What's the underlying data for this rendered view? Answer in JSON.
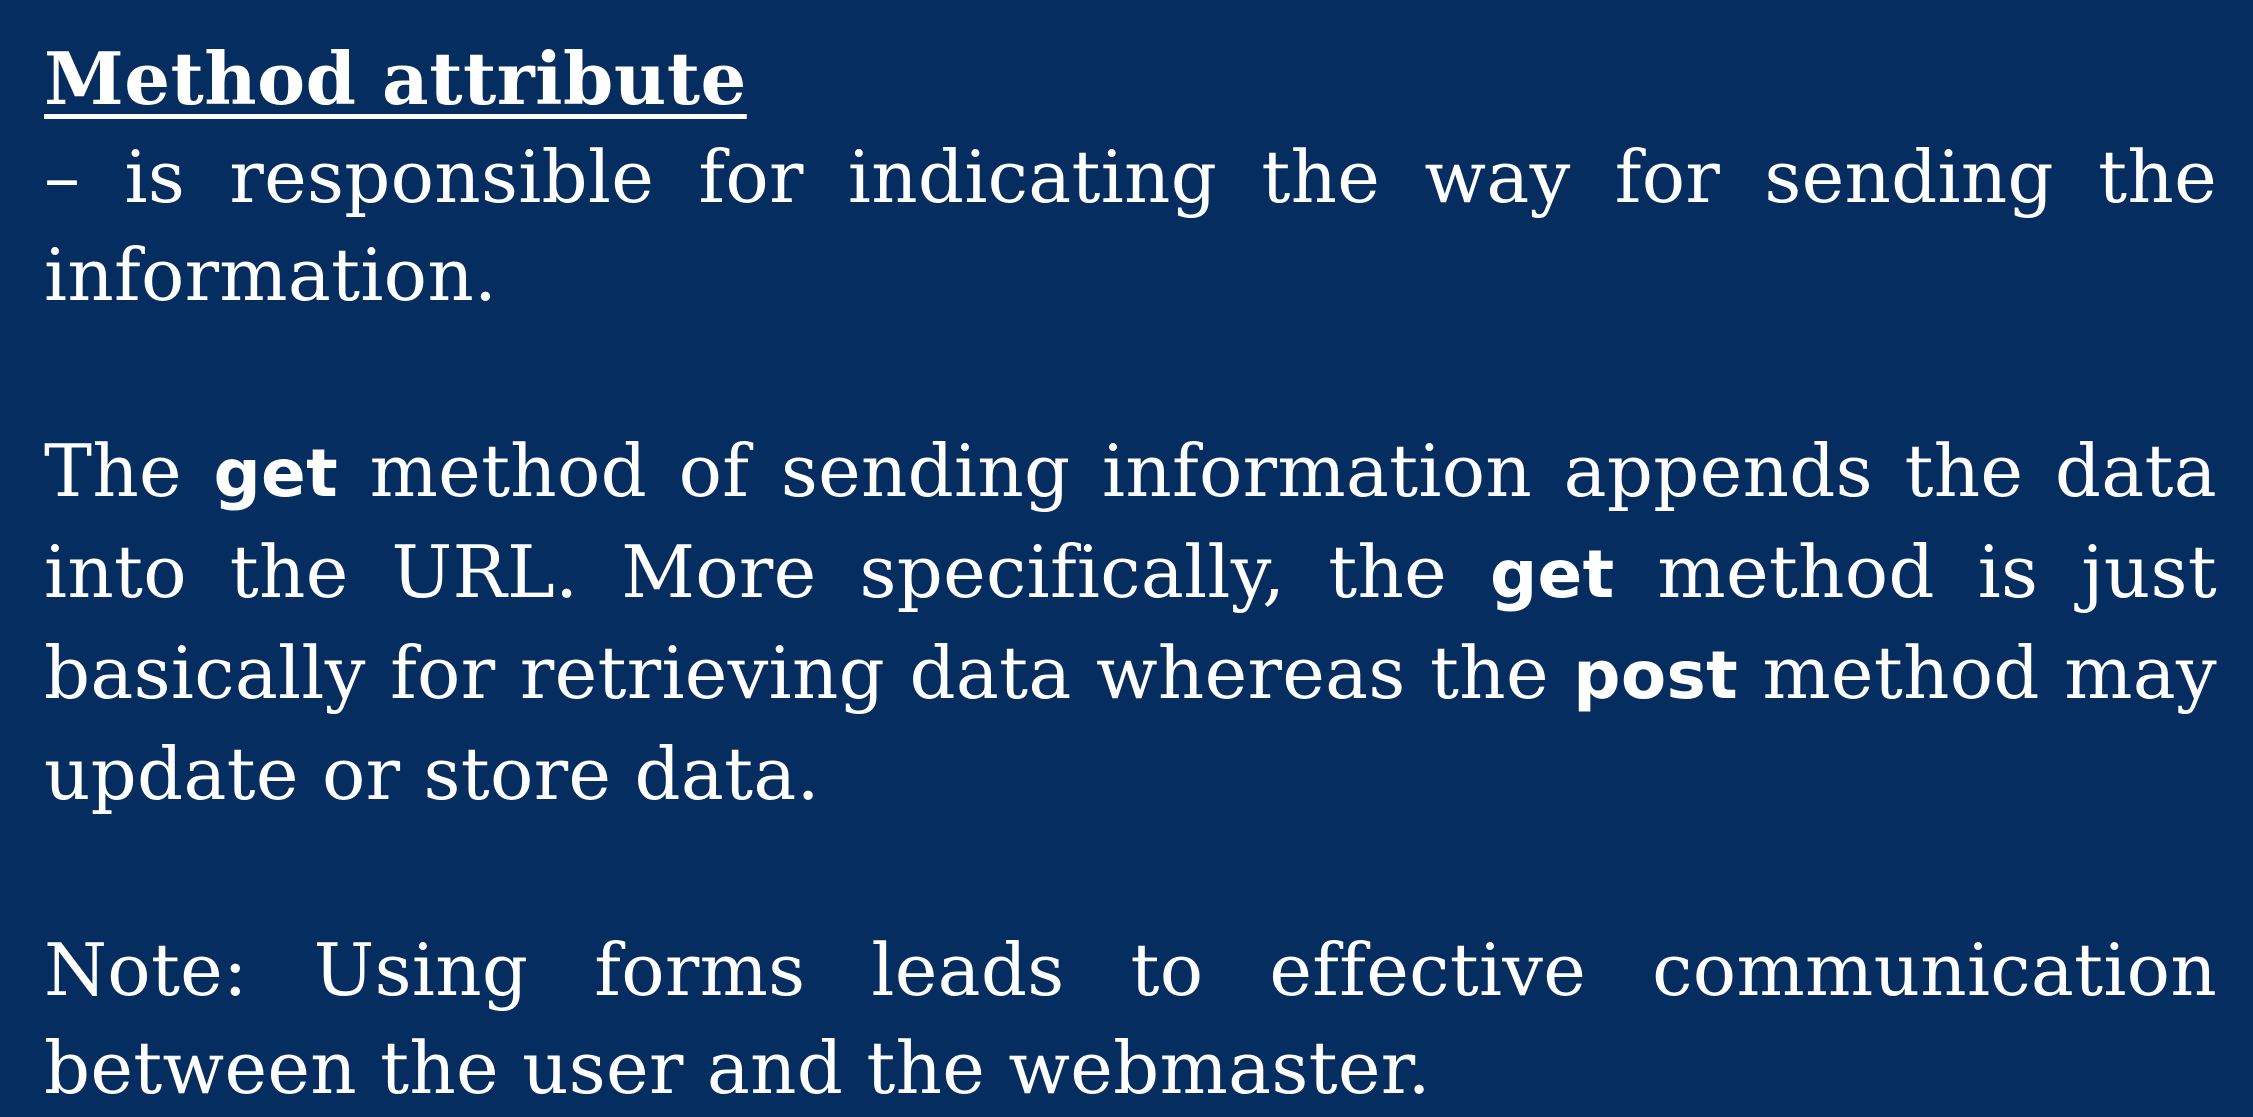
{
  "heading": "Method attribute",
  "definition": "– is responsible for indicating the way for sending the information.",
  "get_paragraph": {
    "p1": "The ",
    "kw1": "get",
    "p2": " method of sending information appends the data into the URL.  More specifically, the ",
    "kw2": "get",
    "p3": " method is just basically for retrieving data whereas the ",
    "kw3": "post",
    "p4": " method may update or store data."
  },
  "note": "Note:  Using forms leads to effective communication between the user and the webmaster.",
  "colors": {
    "background": "#062d5f",
    "text": "#ffffff"
  }
}
